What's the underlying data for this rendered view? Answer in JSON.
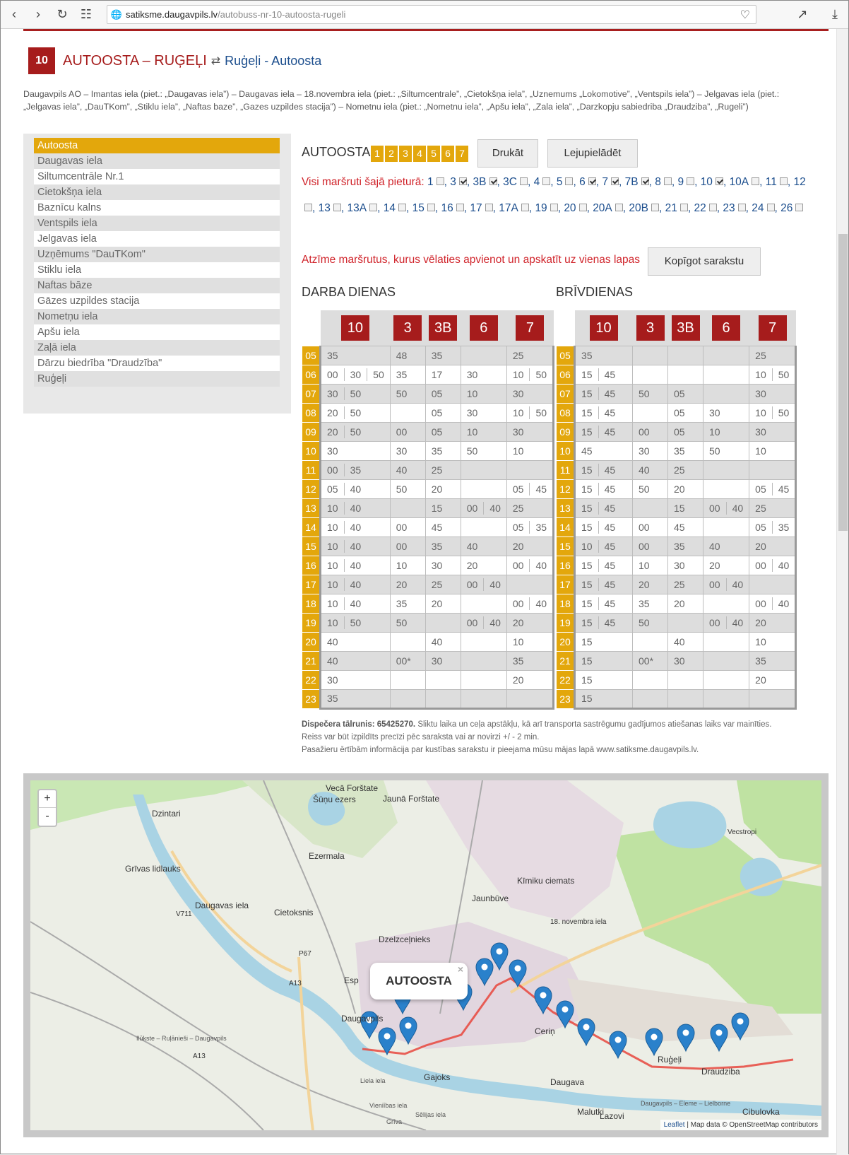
{
  "browser": {
    "url_host": "satiksme.daugavpils.lv",
    "url_path": "/autobuss-nr-10-autoosta-rugeli"
  },
  "header": {
    "route_number": "10",
    "title": "AUTOOSTA – RUĢEĻI",
    "swap_icon": "swap-arrows-icon",
    "reverse_link": "Ruģeļi - Autoosta"
  },
  "description": "Daugavpils AO – Imantas iela (piet.: „Daugavas iela”) – Daugavas iela – 18.novembra iela (piet.: „Siltumcentrale”, „Cietokšņa iela”, „Uznemums „Lokomotive”, „Ventspils iela”) – Jelgavas iela (piet.: „Jelgavas iela”, „DauTKom”, „Stiklu iela”, „Naftas baze”, „Gazes uzpildes stacija”) – Nometnu iela (piet.: „Nometnu iela”, „Apšu iela”, „Zala iela”, „Darzkopju sabiedriba „Draudziba”, „Rugeli”)",
  "stops": [
    "Autoosta",
    "Daugavas iela",
    "Siltumcentrāle Nr.1",
    "Cietokšņa iela",
    "Baznīcu kalns",
    "Ventspils iela",
    "Jelgavas iela",
    "Uzņēmums \"DauTKom\"",
    "Stiklu iela",
    "Naftas bāze",
    "Gāzes uzpildes stacija",
    "Nometņu iela",
    "Apšu iela",
    "Zaļā iela",
    "Dārzu biedrība \"Draudzība\"",
    "Ruģeļi"
  ],
  "panel": {
    "stop_name": "AUTOOSTA",
    "directions": [
      "1",
      "2",
      "3",
      "4",
      "5",
      "6",
      "7"
    ],
    "print_label": "Drukāt",
    "download_label": "Lejupielādēt",
    "all_routes_label": "Visi maršruti šajā pieturā:",
    "note": "Atzīme maršrutus, kurus vēlaties apvienot un apskatīt uz vienas lapas",
    "share_label": "Kopīgot sarakstu"
  },
  "all_routes": [
    {
      "n": "1",
      "on": false
    },
    {
      "n": "3",
      "on": true
    },
    {
      "n": "3B",
      "on": true
    },
    {
      "n": "3C",
      "on": false
    },
    {
      "n": "4",
      "on": false
    },
    {
      "n": "5",
      "on": false
    },
    {
      "n": "6",
      "on": true
    },
    {
      "n": "7",
      "on": true
    },
    {
      "n": "7B",
      "on": true
    },
    {
      "n": "8",
      "on": false
    },
    {
      "n": "9",
      "on": false
    },
    {
      "n": "10",
      "on": true
    },
    {
      "n": "10A",
      "on": false
    },
    {
      "n": "11",
      "on": false
    },
    {
      "n": "12",
      "on": false
    },
    {
      "n": "13",
      "on": false
    },
    {
      "n": "13A",
      "on": false
    },
    {
      "n": "14",
      "on": false
    },
    {
      "n": "15",
      "on": false
    },
    {
      "n": "16",
      "on": false
    },
    {
      "n": "17",
      "on": false
    },
    {
      "n": "17A",
      "on": false
    },
    {
      "n": "19",
      "on": false
    },
    {
      "n": "20",
      "on": false
    },
    {
      "n": "20A",
      "on": false
    },
    {
      "n": "20B",
      "on": false
    },
    {
      "n": "21",
      "on": false
    },
    {
      "n": "22",
      "on": false
    },
    {
      "n": "23",
      "on": false
    },
    {
      "n": "24",
      "on": false
    },
    {
      "n": "26",
      "on": false
    }
  ],
  "hours": [
    "05",
    "06",
    "07",
    "08",
    "09",
    "10",
    "11",
    "12",
    "13",
    "14",
    "15",
    "16",
    "17",
    "18",
    "19",
    "20",
    "21",
    "22",
    "23"
  ],
  "routes": [
    "10",
    "3",
    "3B",
    "6",
    "7"
  ],
  "workdays": {
    "label": "DARBA DIENAS",
    "data": [
      [
        [
          "35"
        ],
        [
          "48"
        ],
        [
          "35"
        ],
        [],
        [
          "25"
        ]
      ],
      [
        [
          "00",
          "30",
          "50"
        ],
        [
          "35"
        ],
        [
          "17"
        ],
        [
          "30"
        ],
        [
          "10",
          "50"
        ]
      ],
      [
        [
          "30",
          "50"
        ],
        [
          "50"
        ],
        [
          "05"
        ],
        [
          "10"
        ],
        [
          "30"
        ]
      ],
      [
        [
          "20",
          "50"
        ],
        [],
        [
          "05"
        ],
        [
          "30"
        ],
        [
          "10",
          "50"
        ]
      ],
      [
        [
          "20",
          "50"
        ],
        [
          "00"
        ],
        [
          "05"
        ],
        [
          "10"
        ],
        [
          "30"
        ]
      ],
      [
        [
          "30"
        ],
        [
          "30"
        ],
        [
          "35"
        ],
        [
          "50"
        ],
        [
          "10"
        ]
      ],
      [
        [
          "00",
          "35"
        ],
        [
          "40"
        ],
        [
          "25"
        ],
        [],
        []
      ],
      [
        [
          "05",
          "40"
        ],
        [
          "50"
        ],
        [
          "20"
        ],
        [],
        [
          "05",
          "45"
        ]
      ],
      [
        [
          "10",
          "40"
        ],
        [],
        [
          "15"
        ],
        [
          "00",
          "40"
        ],
        [
          "25"
        ]
      ],
      [
        [
          "10",
          "40"
        ],
        [
          "00"
        ],
        [
          "45"
        ],
        [],
        [
          "05",
          "35"
        ]
      ],
      [
        [
          "10",
          "40"
        ],
        [
          "00"
        ],
        [
          "35"
        ],
        [
          "40"
        ],
        [
          "20"
        ]
      ],
      [
        [
          "10",
          "40"
        ],
        [
          "10"
        ],
        [
          "30"
        ],
        [
          "20"
        ],
        [
          "00",
          "40"
        ]
      ],
      [
        [
          "10",
          "40"
        ],
        [
          "20"
        ],
        [
          "25"
        ],
        [
          "00",
          "40"
        ],
        []
      ],
      [
        [
          "10",
          "40"
        ],
        [
          "35"
        ],
        [
          "20"
        ],
        [],
        [
          "00",
          "40"
        ]
      ],
      [
        [
          "10",
          "50"
        ],
        [
          "50"
        ],
        [],
        [
          "00",
          "40"
        ],
        [
          "20"
        ]
      ],
      [
        [
          "40"
        ],
        [],
        [
          "40"
        ],
        [],
        [
          "10"
        ]
      ],
      [
        [
          "40"
        ],
        [
          "00*"
        ],
        [
          "30"
        ],
        [],
        [
          "35"
        ]
      ],
      [
        [
          "30"
        ],
        [],
        [],
        [],
        [
          "20"
        ]
      ],
      [
        [
          "35"
        ],
        [],
        [],
        [],
        []
      ]
    ]
  },
  "holidays": {
    "label": "BRĪVDIENAS",
    "data": [
      [
        [
          "35"
        ],
        [],
        [],
        [],
        [
          "25"
        ]
      ],
      [
        [
          "15",
          "45"
        ],
        [],
        [],
        [],
        [
          "10",
          "50"
        ]
      ],
      [
        [
          "15",
          "45"
        ],
        [
          "50"
        ],
        [
          "05"
        ],
        [],
        [
          "30"
        ]
      ],
      [
        [
          "15",
          "45"
        ],
        [],
        [
          "05"
        ],
        [
          "30"
        ],
        [
          "10",
          "50"
        ]
      ],
      [
        [
          "15",
          "45"
        ],
        [
          "00"
        ],
        [
          "05"
        ],
        [
          "10"
        ],
        [
          "30"
        ]
      ],
      [
        [
          "45"
        ],
        [
          "30"
        ],
        [
          "35"
        ],
        [
          "50"
        ],
        [
          "10"
        ]
      ],
      [
        [
          "15",
          "45"
        ],
        [
          "40"
        ],
        [
          "25"
        ],
        [],
        []
      ],
      [
        [
          "15",
          "45"
        ],
        [
          "50"
        ],
        [
          "20"
        ],
        [],
        [
          "05",
          "45"
        ]
      ],
      [
        [
          "15",
          "45"
        ],
        [],
        [
          "15"
        ],
        [
          "00",
          "40"
        ],
        [
          "25"
        ]
      ],
      [
        [
          "15",
          "45"
        ],
        [
          "00"
        ],
        [
          "45"
        ],
        [],
        [
          "05",
          "35"
        ]
      ],
      [
        [
          "10",
          "45"
        ],
        [
          "00"
        ],
        [
          "35"
        ],
        [
          "40"
        ],
        [
          "20"
        ]
      ],
      [
        [
          "15",
          "45"
        ],
        [
          "10"
        ],
        [
          "30"
        ],
        [
          "20"
        ],
        [
          "00",
          "40"
        ]
      ],
      [
        [
          "15",
          "45"
        ],
        [
          "20"
        ],
        [
          "25"
        ],
        [
          "00",
          "40"
        ],
        []
      ],
      [
        [
          "15",
          "45"
        ],
        [
          "35"
        ],
        [
          "20"
        ],
        [],
        [
          "00",
          "40"
        ]
      ],
      [
        [
          "15",
          "45"
        ],
        [
          "50"
        ],
        [],
        [
          "00",
          "40"
        ],
        [
          "20"
        ]
      ],
      [
        [
          "15"
        ],
        [],
        [
          "40"
        ],
        [],
        [
          "10"
        ]
      ],
      [
        [
          "15"
        ],
        [
          "00*"
        ],
        [
          "30"
        ],
        [],
        [
          "35"
        ]
      ],
      [
        [
          "15"
        ],
        [],
        [],
        [],
        [
          "20"
        ]
      ],
      [
        [
          "15"
        ],
        [],
        [],
        [],
        []
      ]
    ]
  },
  "footer": {
    "phone_label": "Dispečera tālrunis: 65425270.",
    "line1": "Sliktu laika un ceļa apstākļu, kā arī transporta sastrēgumu gadījumos atiešanas laiks var mainīties.",
    "line2": "Reiss var būt izpildīts precīzi pēc saraksta vai ar novirzi +/ - 2 min.",
    "line3": "Pasažieru ērtībām informācija par kustības sarakstu ir pieejama mūsu mājas lapā www.satiksme.daugavpils.lv."
  },
  "map": {
    "zoom_in": "+",
    "zoom_out": "-",
    "popup": "AUTOOSTA",
    "close": "×",
    "attribution_link": "Leaflet",
    "attribution_text": " | Map data © OpenStreetMap contributors",
    "labels": [
      "Vecā Forštate",
      "Jaunā Forštate",
      "Šūņu ezers",
      "Dzintari",
      "Grīvas lidlauks",
      "Ezermala",
      "Kīmiku ciemats",
      "Jaunbūve",
      "Cietoksnis",
      "Dzelzceļnieks",
      "Daugavas iela",
      "18. novembra iela",
      "V711",
      "P67",
      "A13",
      "A13",
      "Vecstropi",
      "Daugavpils",
      "Esp",
      "Ceriņ",
      "Ruģeļi",
      "Draudziba",
      "Gajoks",
      "Daugava",
      "Malutki",
      "Lazovi",
      "Cibulovka",
      "Ilūkste – Ruļānieši – Daugavpils",
      "Daugavpils – Eleme – Lielborne",
      "Liela iela",
      "Vieniības iela",
      "Sēlijas iela",
      "Grīva"
    ]
  }
}
